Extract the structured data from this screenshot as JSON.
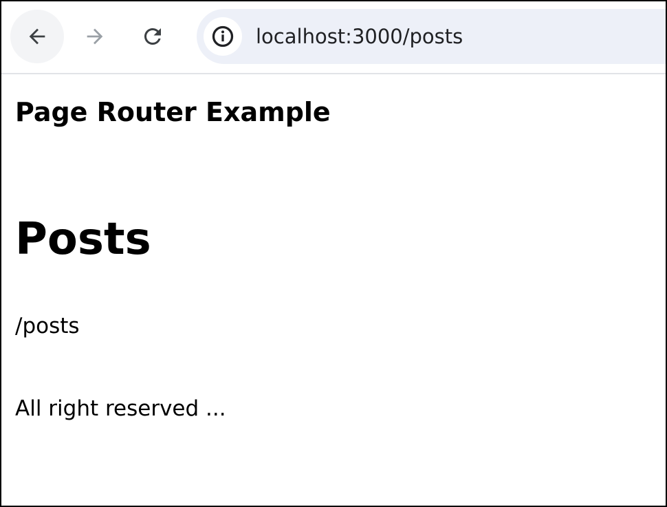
{
  "browser": {
    "url": "localhost:3000/posts",
    "icons": {
      "back": "arrow-left-icon",
      "forward": "arrow-right-icon",
      "reload": "reload-icon",
      "site_info": "info-icon"
    },
    "colors": {
      "toolbar_bg": "#ffffff",
      "omnibox_bg": "#edf0f8",
      "back_button_bg": "#f3f4f6",
      "icon_active": "#3c4043",
      "icon_disabled": "#9aa0a6"
    }
  },
  "page": {
    "header": "Page Router Example",
    "title": "Posts",
    "path": "/posts",
    "footer": "All right reserved ..."
  }
}
